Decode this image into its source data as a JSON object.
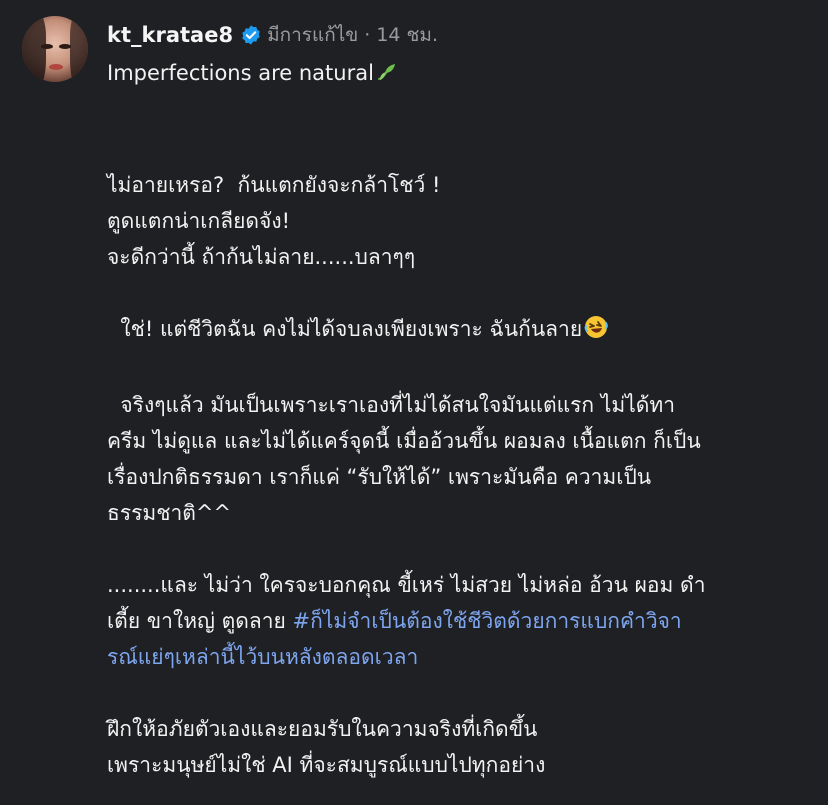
{
  "post": {
    "username": "kt_kratae8",
    "edited_label": "มีการแก้ไข",
    "separator": "·",
    "time": "14 ชม.",
    "title_text": "Imperfections are natural",
    "title_emoji": "herb-leaf-icon",
    "paragraph_1": [
      "ไม่อายเหรอ?  ก้นแตกยังจะกล้าโชว์ !",
      "ตูดแตกน่าเกลียดจัง!",
      "จะดีกว่านี้ ถ้าก้นไม่ลาย......บลาๆๆ"
    ],
    "paragraph_2_text": "  ใช่! แต่ชีวิตฉัน คงไม่ได้จบลงเพียงเพราะ ฉันก้นลาย",
    "paragraph_2_emoji": "rolling-on-floor-laughing-icon",
    "paragraph_3": [
      "  จริงๆแล้ว มันเป็นเพราะเราเองที่ไม่ได้สนใจมันแต่แรก ไม่ได้ทา",
      "ครีม ไม่ดูแล และไม่ได้แคร์จุดนี้ เมื่ออ้วนขึ้น ผอมลง เนื้อแตก ก็เป็น",
      "เรื่องปกติธรรมดา เราก็แค่ “รับให้ได้” เพราะมันคือ ความเป็น",
      "ธรรมชาติ^^"
    ],
    "paragraph_4_line_1": "........และ ไม่ว่า ใครจะบอกคุณ ขี้เหร่ ไม่สวย ไม่หล่อ อ้วน ผอม ดำ",
    "paragraph_4_line_2_text": "เตี้ย ขาใหญ่ ตูดลาย ",
    "hashtag_line_1": "#ก็ไม่จำเป็นต้องใช้ชีวิตด้วยการแบกคำวิจา",
    "hashtag_line_2": "รณ์แย่ๆเหล่านี้ไว้บนหลังตลอดเวลา",
    "paragraph_5": [
      "ฝึกให้อภัยตัวเองและยอมรับในความจริงที่เกิดขึ้น",
      "เพราะมนุษย์ไม่ใช่ AI ที่จะสมบูรณ์แบบไปทุกอย่าง"
    ]
  },
  "colors": {
    "background": "#1f2023",
    "text": "#f2f2f2",
    "muted": "#9a9ba0",
    "hashtag": "#7ea6f0",
    "verified": "#1d9bf0"
  }
}
